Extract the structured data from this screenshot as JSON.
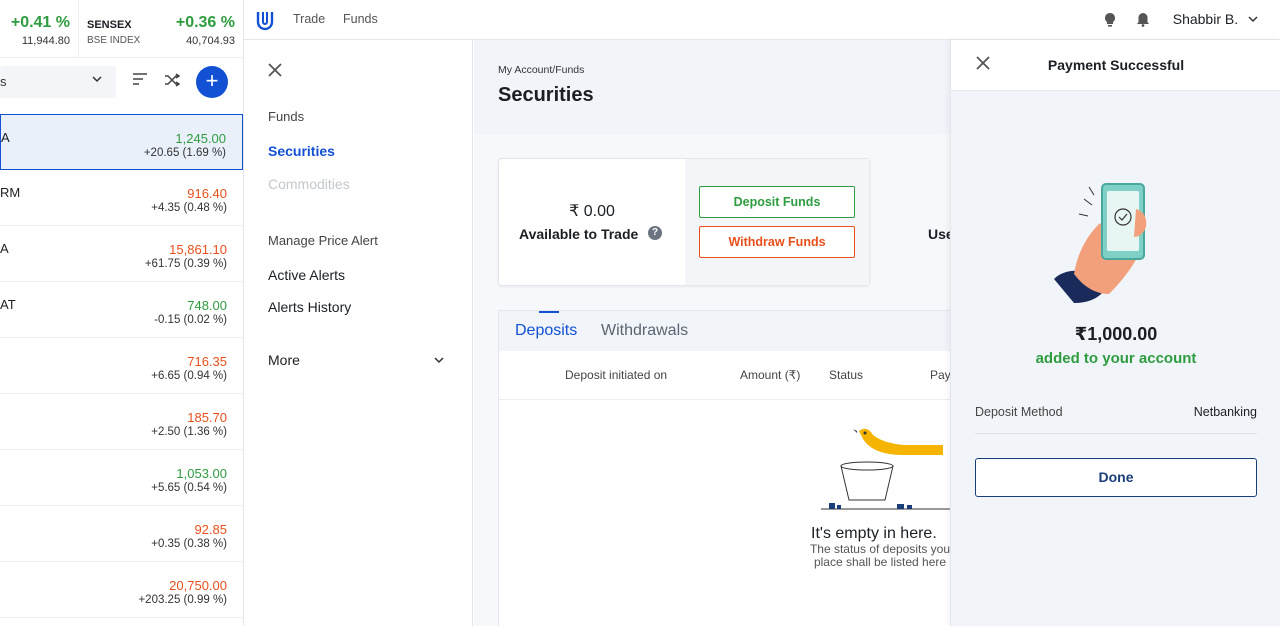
{
  "indices": [
    {
      "name": "",
      "sub": "",
      "change_pct": "+0.41 %",
      "value": "11,944.80"
    },
    {
      "name": "SENSEX",
      "sub": "BSE INDEX",
      "change_pct": "+0.36 %",
      "value": "40,704.93"
    }
  ],
  "watchlist": {
    "dropdown_label": "s",
    "icons": {
      "sort": "sort-icon",
      "shuffle": "shuffle-icon",
      "add": "plus-icon"
    },
    "rows": [
      {
        "symbol": "A",
        "price": "1,245.00",
        "change": "+20.65 (1.69 %)",
        "trend": "green"
      },
      {
        "symbol": "RM",
        "price": "916.40",
        "change": "+4.35 (0.48 %)",
        "trend": "orange"
      },
      {
        "symbol": "A",
        "price": "15,861.10",
        "change": "+61.75 (0.39 %)",
        "trend": "orange"
      },
      {
        "symbol": "AT",
        "price": "748.00",
        "change": "-0.15 (0.02 %)",
        "trend": "green"
      },
      {
        "symbol": "",
        "price": "716.35",
        "change": "+6.65 (0.94 %)",
        "trend": "orange"
      },
      {
        "symbol": "",
        "price": "185.70",
        "change": "+2.50 (1.36 %)",
        "trend": "orange"
      },
      {
        "symbol": "",
        "price": "1,053.00",
        "change": "+5.65 (0.54 %)",
        "trend": "green"
      },
      {
        "symbol": "",
        "price": "92.85",
        "change": "+0.35 (0.38 %)",
        "trend": "orange"
      },
      {
        "symbol": "",
        "price": "20,750.00",
        "change": "+203.25 (0.99 %)",
        "trend": "orange"
      }
    ]
  },
  "topbar": {
    "nav": [
      "Trade",
      "Funds"
    ],
    "user": "Shabbir B."
  },
  "menu": {
    "funds": "Funds",
    "securities": "Securities",
    "commodities": "Commodities",
    "alerts_label": "Manage Price Alert",
    "active_alerts": "Active Alerts",
    "alerts_history": "Alerts History",
    "more": "More"
  },
  "main": {
    "breadcrumb": "My Account/Funds",
    "title": "Securities",
    "balance": "₹ 0.00",
    "balance_label": "Available to Trade",
    "deposit_btn": "Deposit Funds",
    "withdraw_btn": "Withdraw Funds",
    "use_text": "Use",
    "tabs": [
      "Deposits",
      "Withdrawals"
    ],
    "columns": [
      "Deposit initiated on",
      "Amount (₹)",
      "Status",
      "Pay"
    ],
    "empty_title": "It's empty in here.",
    "empty_sub": "The status of deposits you place shall be listed here"
  },
  "side_panel": {
    "title": "Payment Successful",
    "amount": "₹1,000.00",
    "added_text": "added to your account",
    "method_label": "Deposit Method",
    "method_value": "Netbanking",
    "done_btn": "Done"
  },
  "colors": {
    "accent": "#1250d4",
    "positive": "#2e9c3f",
    "negative": "#e8501a"
  }
}
